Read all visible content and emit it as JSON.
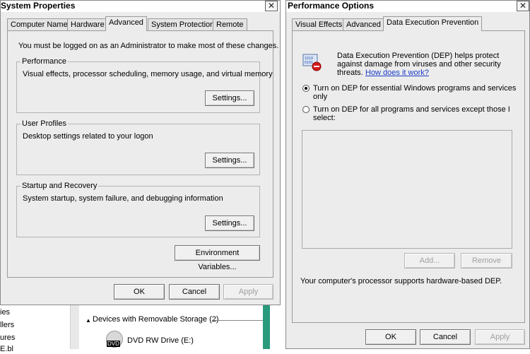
{
  "system_properties": {
    "title": "System Properties",
    "close_glyph": "✕",
    "tabs": [
      "Computer Name",
      "Hardware",
      "Advanced",
      "System Protection",
      "Remote"
    ],
    "active_tab": "Advanced",
    "admin_notice": "You must be logged on as an Administrator to make most of these changes.",
    "groups": {
      "performance": {
        "title": "Performance",
        "description": "Visual effects, processor scheduling, memory usage, and virtual memory",
        "button": "Settings..."
      },
      "user_profiles": {
        "title": "User Profiles",
        "description": "Desktop settings related to your logon",
        "button": "Settings..."
      },
      "startup_recovery": {
        "title": "Startup and Recovery",
        "description": "System startup, system failure, and debugging information",
        "button": "Settings..."
      }
    },
    "env_button": "Environment Variables...",
    "ok": "OK",
    "cancel": "Cancel",
    "apply": "Apply"
  },
  "explorer_background": {
    "left_fragments": [
      "ies",
      "llers",
      "ures",
      "E.bl"
    ],
    "section_header": "Devices with Removable Storage (2)",
    "dvd_label": "DVD RW Drive (E:)",
    "dvd_badge": "DVD"
  },
  "performance_options": {
    "title": "Performance Options",
    "close_glyph": "✕",
    "tabs": [
      "Visual Effects",
      "Advanced",
      "Data Execution Prevention"
    ],
    "active_tab": "Data Execution Prevention",
    "dep_desc_1": "Data Execution Prevention (DEP) helps protect",
    "dep_desc_2": "against damage from viruses and other security",
    "dep_desc_3": "threats.",
    "dep_link": "How does it work?",
    "option_1_line1": "Turn on DEP for essential Windows programs and services",
    "option_1_line2": "only",
    "option_2_line1": "Turn on DEP for all programs and services except those I",
    "option_2_line2": "select:",
    "selected_option": 1,
    "add_button": "Add...",
    "remove_button": "Remove",
    "support_text": "Your computer's processor supports hardware-based DEP.",
    "ok": "OK",
    "cancel": "Cancel",
    "apply": "Apply"
  },
  "colors": {
    "window_bg": "#ececec",
    "link": "#1a3cc8",
    "scrollbar_green": "#2a9a7c"
  }
}
